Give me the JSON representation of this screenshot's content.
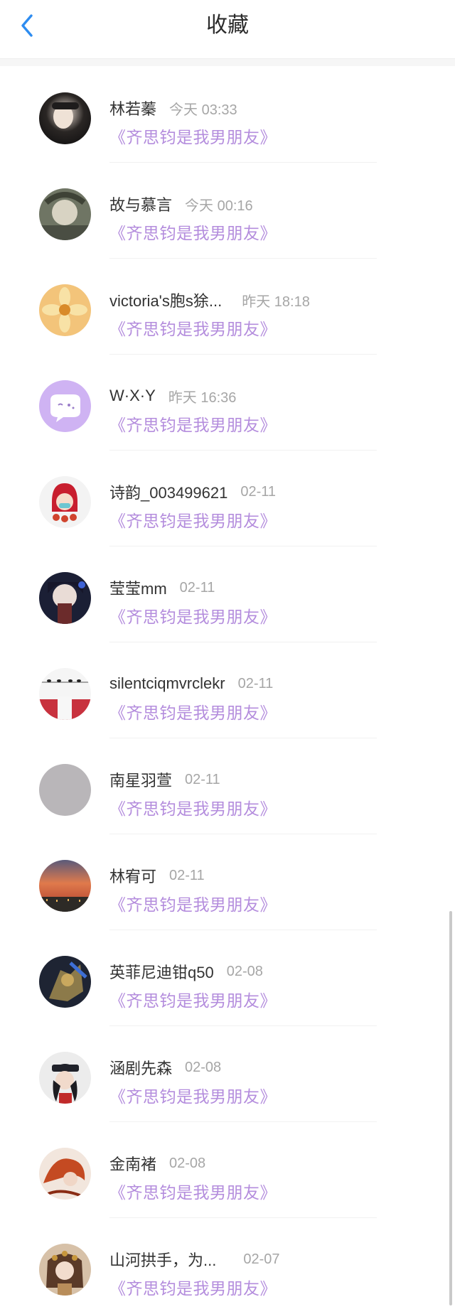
{
  "header": {
    "title": "收藏"
  },
  "items": [
    {
      "name": "林若蓁",
      "time": "今天 03:33",
      "book": "《齐思钧是我男朋友》"
    },
    {
      "name": "故与慕言",
      "time": "今天 00:16",
      "book": "《齐思钧是我男朋友》"
    },
    {
      "name": "victoria's胞s狳...",
      "time": "昨天 18:18",
      "book": "《齐思钧是我男朋友》"
    },
    {
      "name": "W·X·Y",
      "time": "昨天 16:36",
      "book": "《齐思钧是我男朋友》"
    },
    {
      "name": "诗韵_003499621",
      "time": "02-11",
      "book": "《齐思钧是我男朋友》"
    },
    {
      "name": "莹莹mm",
      "time": "02-11",
      "book": "《齐思钧是我男朋友》"
    },
    {
      "name": "silentciqmvrclekr",
      "time": "02-11",
      "book": "《齐思钧是我男朋友》"
    },
    {
      "name": "南星羽萱",
      "time": "02-11",
      "book": "《齐思钧是我男朋友》"
    },
    {
      "name": "林宥可",
      "time": "02-11",
      "book": "《齐思钧是我男朋友》"
    },
    {
      "name": "英菲尼迪钳q50",
      "time": "02-08",
      "book": "《齐思钧是我男朋友》"
    },
    {
      "name": "涵剧先森",
      "time": "02-08",
      "book": "《齐思钧是我男朋友》"
    },
    {
      "name": "金南褚",
      "time": "02-08",
      "book": "《齐思钧是我男朋友》"
    },
    {
      "name": "山河拱手，为...",
      "time": "02-07",
      "book": "《齐思钧是我男朋友》"
    }
  ],
  "colors": {
    "accent": "#2d8cf0",
    "book": "#b48ddd"
  }
}
